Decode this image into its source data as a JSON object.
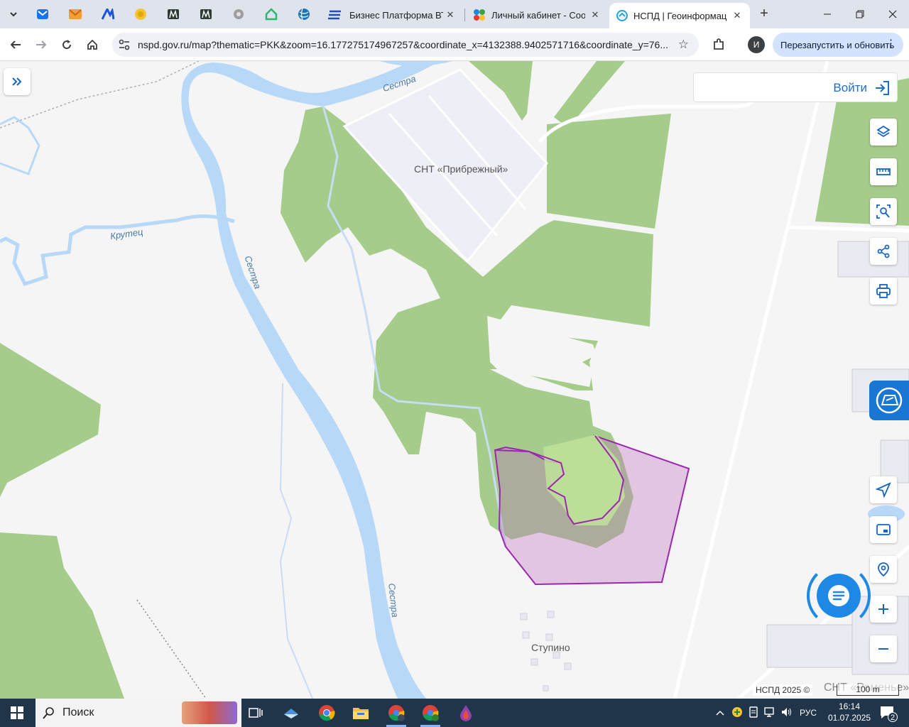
{
  "browser": {
    "tabs": [
      {
        "title": "Бизнес Платформа ВТБ",
        "active": false
      },
      {
        "title": "Личный кабинет - Сооб",
        "active": false
      },
      {
        "title": "НСПД | Геоинформацио",
        "active": true
      }
    ],
    "url": "nspd.gov.ru/map?thematic=PKK&zoom=16.177275174967257&coordinate_x=4132388.9402571716&coordinate_y=76...",
    "profile_initial": "И",
    "relaunch_label": "Перезапустить и обновить"
  },
  "map": {
    "login_label": "Войти",
    "labels": {
      "snt_pribrezhny": "СНТ «Прибрежный»",
      "stupino": "Ступино",
      "snt_ramenye": "СНТ «Раменье»",
      "river_sestra_1": "Сестра",
      "river_sestra_2": "Сестра",
      "river_sestra_3": "Сестра",
      "river_krutets": "Крутец"
    },
    "attribution": "НСПД 2025 ©",
    "scale": "100 m",
    "tools": [
      "layers-icon",
      "ruler-icon",
      "search-area-icon",
      "share-icon",
      "print-icon",
      "navigate-icon",
      "picture-in-picture-icon",
      "geolocate-icon",
      "zoom-in-icon",
      "zoom-out-icon"
    ],
    "colors": {
      "forest": "#a5cc8a",
      "water": "#b8d8f8",
      "parcel_fill": "#e6c8e6",
      "parcel_stroke": "#9c27b0",
      "accent": "#1976d2"
    }
  },
  "taskbar": {
    "search_placeholder": "Поиск",
    "language": "РУС",
    "time": "16:14",
    "date": "01.07.2025",
    "notifications": "2"
  }
}
